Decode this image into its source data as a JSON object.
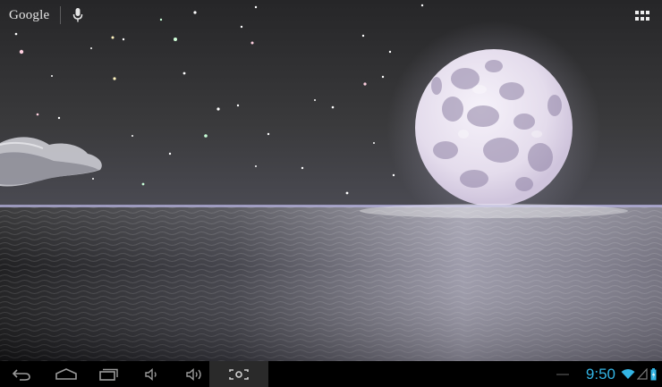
{
  "search": {
    "brand_label": "Google",
    "mic_icon": "microphone-icon"
  },
  "apps": {
    "icon": "all-apps-grid-icon"
  },
  "nav": {
    "back_icon": "back-arrow-icon",
    "home_icon": "home-icon",
    "recents_icon": "recent-apps-icon",
    "volume_down_icon": "volume-down-icon",
    "volume_up_icon": "volume-up-icon",
    "screenshot_icon": "screenshot-icon"
  },
  "status": {
    "time": "9:50",
    "wifi_icon": "wifi-icon",
    "signal_icon": "signal-icon",
    "battery_icon": "battery-charging-icon"
  },
  "colors": {
    "accent": "#33b5e5",
    "sky": "#3b3b3d",
    "sea": "#8e8c9a",
    "moon": "#ece6f0"
  },
  "wallpaper": {
    "scene": "moonlit-sea-live-wallpaper"
  }
}
